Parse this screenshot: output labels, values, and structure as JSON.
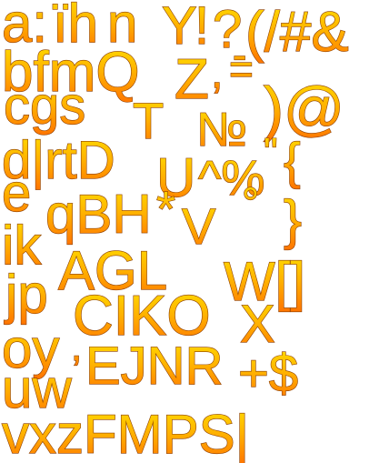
{
  "glyph_sheet": {
    "colors": {
      "fill_top": "#ffe000",
      "fill_mid": "#ffb000",
      "fill_bottom": "#ff7400",
      "outline": "#8a3c00",
      "background": "#ffffff"
    },
    "rows": [
      [
        {
          "t": "a:"
        },
        {
          "t": "ïh"
        },
        {
          "t": "n"
        },
        {
          "t": "Y"
        },
        {
          "t": "!"
        },
        {
          "t": "?"
        },
        {
          "t": "(/#&"
        }
      ],
      [
        {
          "t": "bfmQ"
        },
        {
          "t": "Z"
        },
        {
          "t": ","
        },
        {
          "t": "="
        },
        {
          "t": "-"
        }
      ],
      [
        {
          "t": "cgs"
        },
        {
          "t": "T"
        },
        {
          "t": "№"
        },
        {
          "t": ")@"
        }
      ],
      [
        {
          "t": "d|rtD"
        },
        {
          "t": "U"
        },
        {
          "t": "^%"
        },
        {
          "t": "\""
        },
        {
          "t": "{"
        }
      ],
      [
        {
          "t": "e"
        },
        {
          "t": "qBH"
        },
        {
          "t": "*"
        },
        {
          "t": "V"
        },
        {
          "t": "°"
        },
        {
          "t": "}"
        }
      ],
      [
        {
          "t": "ik"
        },
        {
          "t": "AGL"
        },
        {
          "t": "W[]"
        }
      ],
      [
        {
          "t": "jp"
        },
        {
          "t": "CIKO"
        },
        {
          "t": "X"
        }
      ],
      [
        {
          "t": "oy"
        },
        {
          "t": ","
        },
        {
          "t": "EJNR"
        },
        {
          "t": "+$"
        }
      ],
      [
        {
          "t": "uw"
        }
      ],
      [
        {
          "t": "vxzFMPS|"
        }
      ]
    ]
  }
}
